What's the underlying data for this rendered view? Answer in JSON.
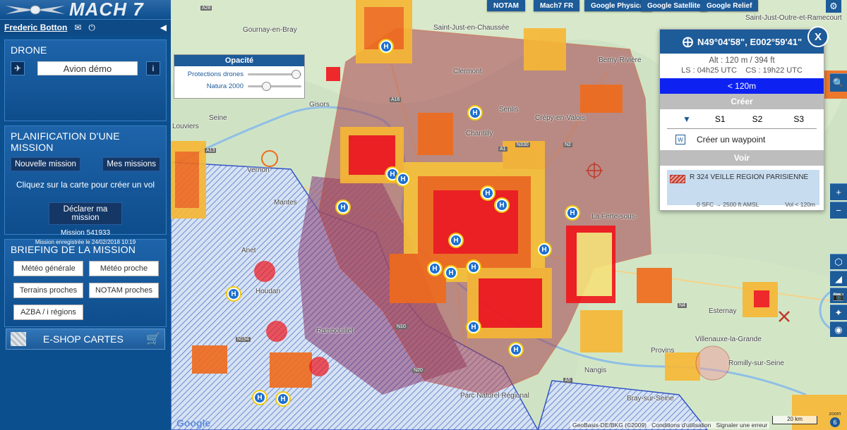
{
  "app": {
    "logo_text": "MACH 7"
  },
  "user": {
    "name": "Frederic Botton"
  },
  "drone": {
    "title": "DRONE",
    "selected_aircraft": "Avion démo",
    "info_label": "i"
  },
  "planning": {
    "title": "PLANIFICATION D'UNE MISSION",
    "new_mission": "Nouvelle mission",
    "my_missions": "Mes missions",
    "hint": "Cliquez sur la carte pour créer un vol",
    "declare": "Déclarer ma mission",
    "mission_id": "Mission 541933",
    "saved": "Mission enregistrée le 24/02/2018 10:19"
  },
  "briefing": {
    "title": "BRIEFING DE LA MISSION",
    "buttons": [
      "Météo générale",
      "Météo proche",
      "Terrains proches",
      "NOTAM proches",
      "AZBA / i régions"
    ]
  },
  "shop": {
    "label": "E-SHOP CARTES"
  },
  "map_buttons": [
    "NOTAM",
    "Mach7 FR",
    "Google Physical",
    "Google Satellite",
    "Google Relief"
  ],
  "opacity": {
    "title": "Opacité",
    "layers": [
      {
        "name": "Protections drones",
        "value": 0.82
      },
      {
        "name": "Natura 2000",
        "value": 0.3
      }
    ]
  },
  "info": {
    "coords": "N49°04'58\", E002°59'41\"",
    "altitude": "Alt : 120 m / 394 ft",
    "ls": "LS : 04h25 UTC",
    "cs": "CS : 19h22 UTC",
    "band": "< 120m",
    "create_title": "Créer",
    "slots": [
      "S1",
      "S2",
      "S3"
    ],
    "waypoint": "Créer un waypoint",
    "see_title": "Voir",
    "zone_name": "R 324 VEILLE REGION PARISIENNE",
    "zone_limits": "0 SFC → 2500 ft AMSL",
    "zone_flight": "Vol < 120m",
    "close": "X"
  },
  "places": [
    "Gournay-en-Bray",
    "Saint-Just-en-Chaussée",
    "Clermont",
    "Berny-Rivière",
    "Crépy-en-Valois",
    "Chantilly",
    "Senlis",
    "Gisors",
    "Louviers",
    "Vernon",
    "Mantes",
    "Rambouillet",
    "Houdan",
    "Anet",
    "La Ferté-sous-",
    "Esternay",
    "Villenauxe-la-Grande",
    "Romilly-sur-Seine",
    "Provins",
    "Bray-sur-Seine",
    "Nangis",
    "Parc Naturel Régional",
    "Seine",
    "Saint-Just-Outre-et-Ramecourt"
  ],
  "road_tags": [
    "A28",
    "A16",
    "A1",
    "N330",
    "N2",
    "A13",
    "N154",
    "N10",
    "N4",
    "A5",
    "N20"
  ],
  "footer": {
    "google": "Google",
    "credits": "GeoBasis-DE/BKG (©2009)",
    "conditions": "Conditions d'utilisation",
    "report": "Signaler une erreur",
    "scale": "20 km",
    "zoom_label": "zoom",
    "zoom_value": "6"
  },
  "colors": {
    "sidebar": "#0c4f8f",
    "accent": "#1d5b99",
    "band_blue": "#0d22f0",
    "restricted_zone": "#c0392b",
    "hot_zone": "#f0151b"
  }
}
